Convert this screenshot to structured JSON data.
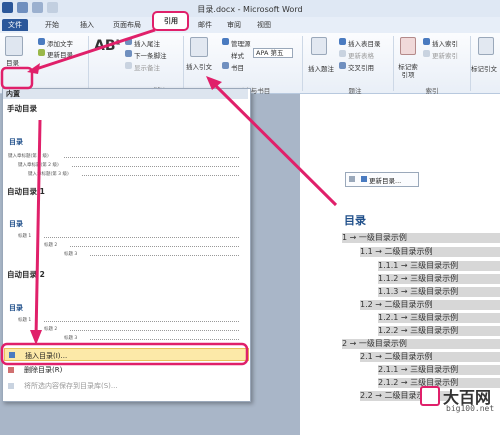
{
  "window": {
    "title": "目录.docx - Microsoft Word"
  },
  "tabs": [
    "文件",
    "开始",
    "插入",
    "页面布局",
    "引用",
    "邮件",
    "审阅",
    "视图"
  ],
  "ribbon": {
    "toc_button": "目录",
    "add_text": "添加文字",
    "update_toc": "更新目录",
    "insert_footnote": "插入尾注",
    "next_footnote": "下一条脚注",
    "show_notes": "显示备注",
    "footnote_group": "脚注",
    "insert_citation": "插入引文",
    "manage_sources": "管理源",
    "style_label": "样式",
    "style_value": "APA 第五",
    "bibliography": "书目",
    "citation_group": "引文与书目",
    "insert_caption": "插入题注",
    "insert_table_of_figures": "插入表目录",
    "update_table": "更新表格",
    "cross_reference": "交叉引用",
    "caption_group": "题注",
    "mark_entry": "标记索引项",
    "insert_index": "插入索引",
    "update_index": "更新索引",
    "index_group": "索引",
    "mark_citation": "标记引文"
  },
  "dropdown": {
    "builtin": "内置",
    "manual_toc": "手动目录",
    "auto_toc_1": "自动目录 1",
    "auto_toc_2": "自动目录 2",
    "toc_heading": "目录",
    "manual_lines": [
      "键入章标题(第 1 级)",
      "键入章标题(第 2 级)",
      "键入章标题(第 3 级)"
    ],
    "auto1_lines": [
      "标题 1",
      "标题 2",
      "标题 3"
    ],
    "auto2_lines": [
      "标题 1",
      "标题 2",
      "标题 3"
    ],
    "insert_toc": "插入目录(I)...",
    "remove_toc": "删除目录(R)",
    "save_selection": "将所选内容保存到目录库(S)..."
  },
  "document": {
    "mini_update": "更新目录...",
    "toc_title": "目录",
    "toc_entries": [
      "1 → 一级目录示例",
      "1.1 → 二级目录示例",
      "1.1.1 → 三级目录示例",
      "1.1.2 → 三级目录示例",
      "1.1.3 → 三级目录示例",
      "1.2 → 二级目录示例",
      "1.2.1 → 三级目录示例",
      "1.2.2 → 三级目录示例",
      "2 → 一级目录示例",
      "2.1 → 二级目录示例",
      "2.1.1 → 三级目录示例",
      "2.1.2 → 三级目录示例",
      "2.2 → 二级目录示例"
    ]
  },
  "watermark": {
    "name": "大百网",
    "url": "big100.net"
  },
  "colors": {
    "highlight": "#e0206a",
    "file_tab": "#2b579a",
    "menu_hover": "#fce9a8"
  }
}
